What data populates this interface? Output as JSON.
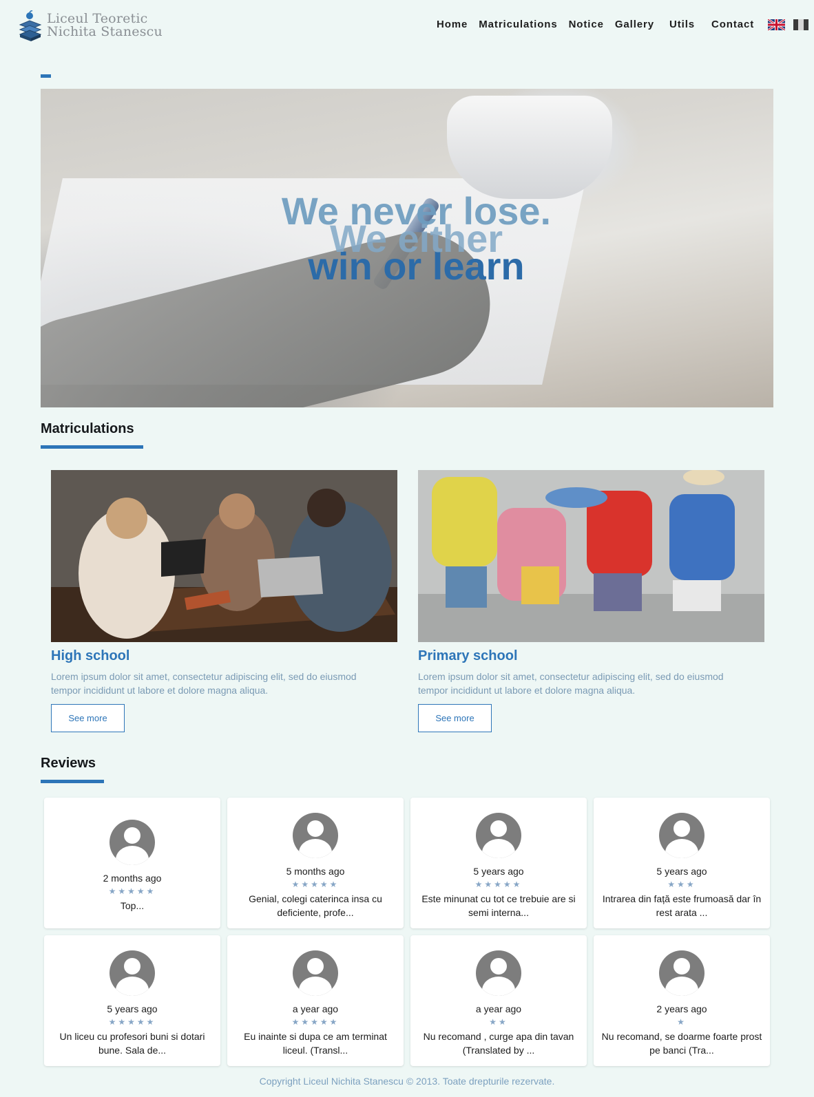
{
  "brand": {
    "line1": "Liceul Teoretic",
    "line2": "Nichita Stanescu"
  },
  "nav": {
    "items": [
      {
        "label": "Home"
      },
      {
        "label": "Matriculations"
      },
      {
        "label": "Notice"
      },
      {
        "label": "Gallery"
      },
      {
        "label": "Utils"
      },
      {
        "label": "Contact"
      }
    ],
    "languages": [
      "english-flag-icon",
      "romanian-flag-icon"
    ]
  },
  "hero": {
    "line1": "We never lose.",
    "line2": "We either",
    "line3": "win or learn"
  },
  "matriculations": {
    "title": "Matriculations",
    "cards": [
      {
        "title": "High school",
        "text": "Lorem ipsum dolor sit amet, consectetur adipiscing elit, sed do eiusmod tempor incididunt ut labore et dolore magna aliqua.",
        "button": "See more"
      },
      {
        "title": "Primary school",
        "text": "Lorem ipsum dolor sit amet, consectetur adipiscing elit, sed do eiusmod tempor incididunt ut labore et dolore magna aliqua.",
        "button": "See more"
      }
    ]
  },
  "reviews": {
    "title": "Reviews",
    "items": [
      {
        "time": "2 months ago",
        "stars": "★★★★★",
        "rating": 5,
        "text": "Top..."
      },
      {
        "time": "5 months ago",
        "stars": "★★★★★",
        "rating": 5,
        "text": "Genial, colegi caterinca insa cu deficiente, profe..."
      },
      {
        "time": "5 years ago",
        "stars": "★★★★★",
        "rating": 5,
        "text": "Este minunat cu tot ce trebuie are si semi interna..."
      },
      {
        "time": "5 years ago",
        "stars": "★★★",
        "rating": 3,
        "text": "Intrarea din față este frumoasă dar în rest arata ..."
      },
      {
        "time": "5 years ago",
        "stars": "★★★★★",
        "rating": 5,
        "text": "Un liceu cu profesori buni si dotari bune. Sala de..."
      },
      {
        "time": "a year ago",
        "stars": "★★★★★",
        "rating": 5,
        "text": "Eu inainte si dupa ce am terminat liceul. (Transl..."
      },
      {
        "time": "a year ago",
        "stars": "★★",
        "rating": 2,
        "text": "Nu recomand , curge apa din tavan (Translated by ..."
      },
      {
        "time": "2 years ago",
        "stars": "★",
        "rating": 1,
        "text": "Nu recomand, se doarme foarte prost pe banci (Tra..."
      }
    ]
  },
  "footer": {
    "copyright": "Copyright Liceul Nichita Stanescu © 2013. Toate drepturile rezervate."
  },
  "colors": {
    "accent": "#2d75b8",
    "background": "#eef7f5",
    "muted_text": "#7a9ab4"
  }
}
